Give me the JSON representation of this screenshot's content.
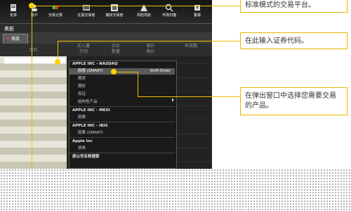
{
  "toolbar": {
    "items": [
      {
        "label": "定单",
        "icon": "order-icon"
      },
      {
        "label": "账户",
        "icon": "account-icon"
      },
      {
        "label": "交易记录",
        "icon": "trades-icon"
      },
      {
        "label": "在股交易者",
        "icon": "trader-icon"
      },
      {
        "label": "期权交易者",
        "icon": "options-icon"
      },
      {
        "label": "风险导航",
        "icon": "risk-icon"
      },
      {
        "label": "市场扫描",
        "icon": "scanner-icon"
      },
      {
        "label": "警报",
        "icon": "alert-icon"
      }
    ]
  },
  "window": {
    "title": "美股",
    "subtab": "美股"
  },
  "columns": {
    "contract": "合约",
    "buy": "买入量\n行动",
    "bid": "买价\n数量",
    "ask": "卖价\n卖价",
    "extra": "有效期"
  },
  "popup": {
    "items": [
      {
        "text": "APPLE INC - NASDAQ",
        "kind": "header"
      },
      {
        "text": "股票 (SMART)",
        "kind": "selected",
        "shortcut": "Shift-Enter"
      },
      {
        "text": "期货",
        "kind": "item"
      },
      {
        "text": "期权",
        "kind": "item"
      },
      {
        "text": "权证",
        "kind": "item"
      },
      {
        "text": "结构性产品",
        "kind": "item"
      },
      {
        "text": "APPLE INC - MEXI",
        "kind": "header"
      },
      {
        "text": "股票",
        "kind": "item"
      },
      {
        "text": "APPLE INC - IBIS",
        "kind": "header"
      },
      {
        "text": "股票 (SMART)",
        "kind": "item"
      },
      {
        "text": "Apple Inc",
        "kind": "header"
      },
      {
        "text": "债券",
        "kind": "item"
      },
      {
        "text": "按公司名称搜索",
        "kind": "header"
      }
    ]
  },
  "callouts": [
    "标准模式的交易平台。",
    "在此输入证券代码。",
    "在弹出窗口中选择您需要交易的产品。"
  ],
  "colors": {
    "accent": "#f0c000",
    "row_odd": "#c9c6b4",
    "row_even": "#e7e5d8",
    "selected": "#5a5a5a"
  }
}
